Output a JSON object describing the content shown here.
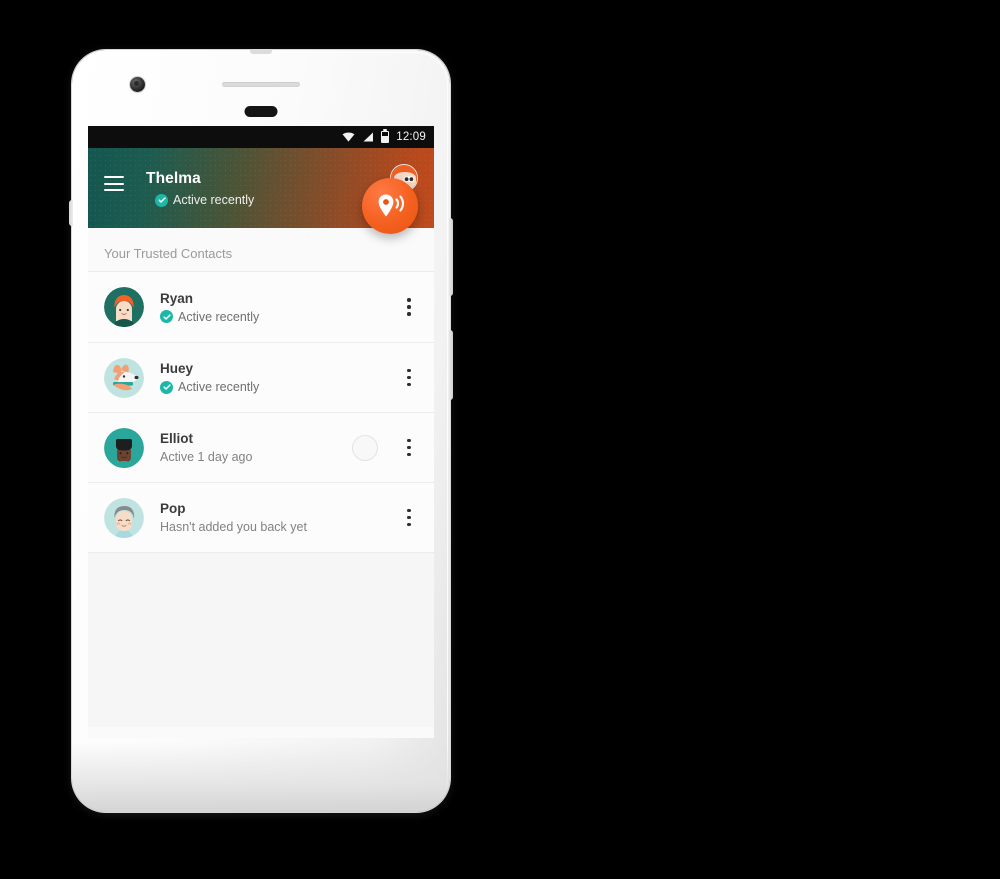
{
  "device": {
    "name": "android-phone-mockup",
    "frame_color": "#f4f4f4"
  },
  "statusbar": {
    "time": "12:09",
    "icons": [
      "wifi-icon",
      "cellular-signal-icon",
      "battery-icon"
    ]
  },
  "appbar": {
    "menu_icon": "hamburger-menu-icon",
    "user_name": "Thelma",
    "status_label": "Active recently",
    "status_badge_icon": "verified-check-icon",
    "avatar_icon": "profile-avatar-thelma",
    "gradient_from": "#13574f",
    "gradient_to": "#bf4b1d"
  },
  "fab": {
    "icon": "location-broadcast-icon",
    "color": "#ea5514"
  },
  "main": {
    "section_title": "Your Trusted Contacts",
    "contacts": [
      {
        "name": "Ryan",
        "status": "Active recently",
        "verified": true,
        "avatar": "avatar-ryan",
        "overflow_icon": "overflow-menu-icon",
        "ripple": false
      },
      {
        "name": "Huey",
        "status": "Active recently",
        "verified": true,
        "avatar": "avatar-huey-dog",
        "overflow_icon": "overflow-menu-icon",
        "ripple": false
      },
      {
        "name": "Elliot",
        "status": "Active 1 day ago",
        "verified": false,
        "avatar": "avatar-elliot",
        "overflow_icon": "overflow-menu-icon",
        "ripple": true
      },
      {
        "name": "Pop",
        "status": "Hasn't added you back yet",
        "verified": false,
        "avatar": "avatar-pop",
        "overflow_icon": "overflow-menu-icon",
        "ripple": false
      }
    ]
  },
  "colors": {
    "accent_teal": "#1bb7a8",
    "accent_orange": "#ea5514",
    "screen_bg": "#fafafa",
    "list_bg": "#fcfcfc",
    "empty_bg": "#f6f6f6"
  }
}
